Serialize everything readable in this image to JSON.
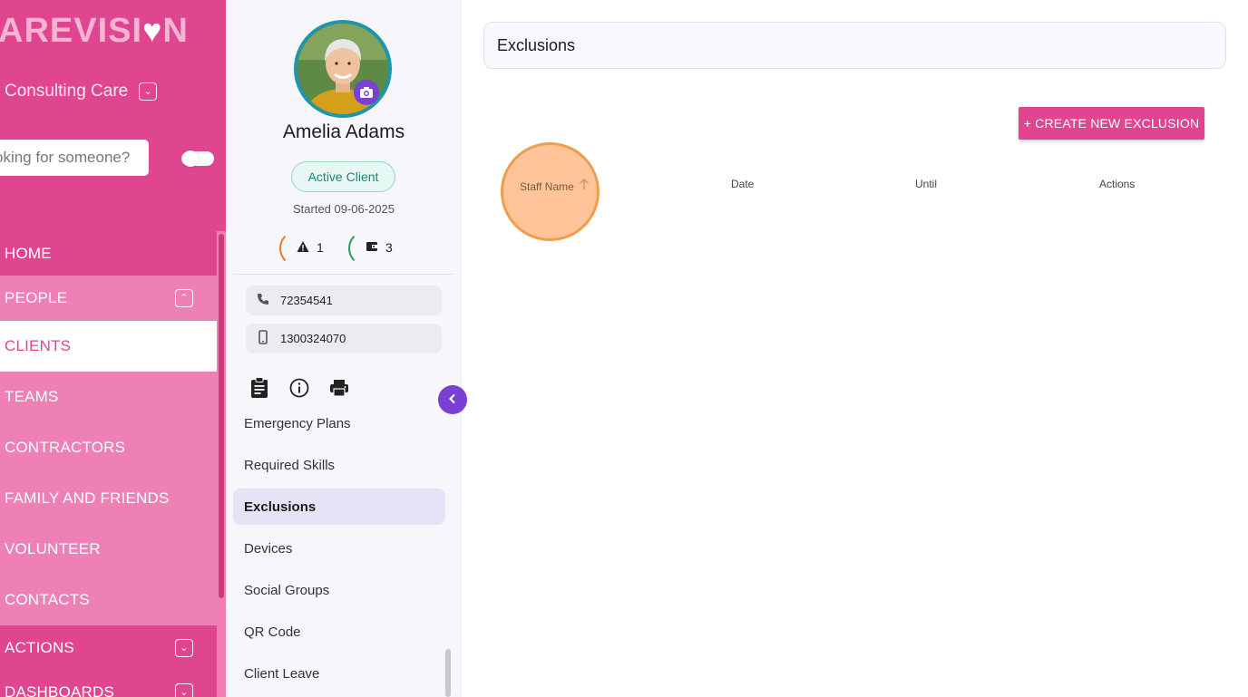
{
  "brand": {
    "text": "AREVISI",
    "suffix": "N"
  },
  "company": {
    "name": "Consulting Care"
  },
  "search": {
    "placeholder": "oking for someone?"
  },
  "nav": {
    "items": [
      {
        "label": "HOME"
      },
      {
        "label": "PEOPLE"
      },
      {
        "label": "CLIENTS"
      },
      {
        "label": "TEAMS"
      },
      {
        "label": "CONTRACTORS"
      },
      {
        "label": "FAMILY AND FRIENDS"
      },
      {
        "label": "VOLUNTEER"
      },
      {
        "label": "CONTACTS"
      },
      {
        "label": "ACTIONS"
      },
      {
        "label": "DASHBOARDS"
      }
    ]
  },
  "profile": {
    "name": "Amelia Adams",
    "status": "Active Client",
    "started": "Started 09-06-2025",
    "alerts_count": "1",
    "wallet_count": "3",
    "phone": "72354541",
    "mobile": "1300324070",
    "menu": [
      {
        "label": "Emergency Plans"
      },
      {
        "label": "Required Skills"
      },
      {
        "label": "Exclusions"
      },
      {
        "label": "Devices"
      },
      {
        "label": "Social Groups"
      },
      {
        "label": "QR Code"
      },
      {
        "label": "Client Leave"
      }
    ]
  },
  "main": {
    "title": "Exclusions",
    "create_label": "+ CREATE NEW EXCLUSION",
    "columns": [
      {
        "label": "Staff Name"
      },
      {
        "label": "Date"
      },
      {
        "label": "Until"
      },
      {
        "label": "Actions"
      }
    ]
  },
  "colors": {
    "brand_pink": "#e0458f",
    "accent_purple": "#7b3fd6",
    "active_teal": "#168a74"
  }
}
